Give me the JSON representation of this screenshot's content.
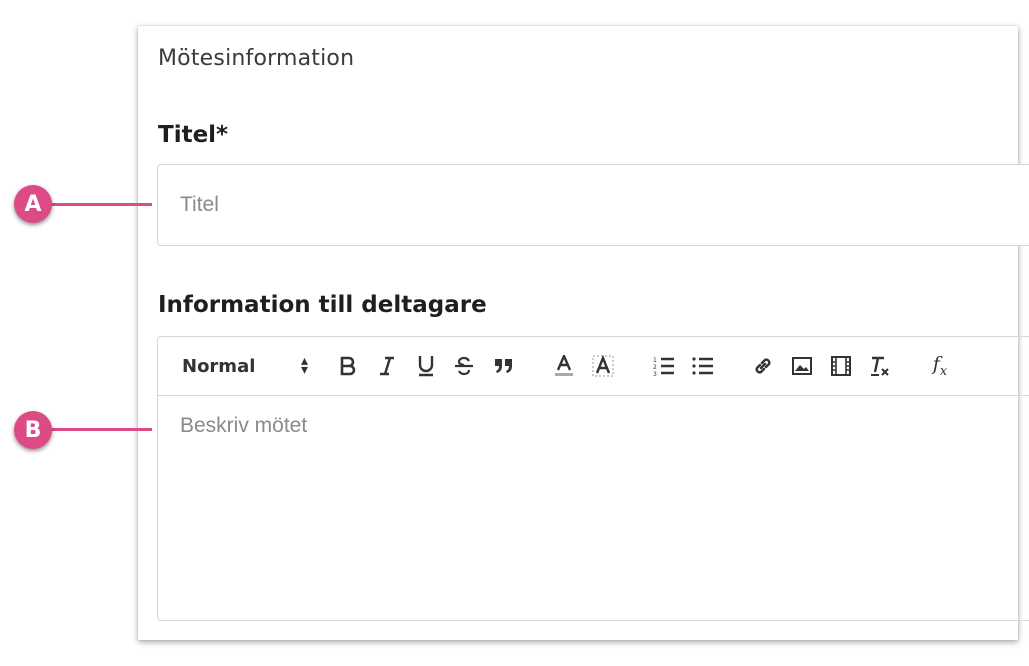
{
  "section": {
    "title": "Mötesinformation"
  },
  "title_field": {
    "label": "Titel*",
    "placeholder": "Titel",
    "value": ""
  },
  "info_field": {
    "label": "Information till deltagare",
    "placeholder": "Beskriv mötet",
    "toolbar": {
      "heading_value": "Normal",
      "buttons": [
        "bold-icon",
        "italic-icon",
        "underline-icon",
        "strikethrough-icon",
        "blockquote-icon",
        "font-color-icon",
        "highlight-icon",
        "ordered-list-icon",
        "bullet-list-icon",
        "link-icon",
        "image-icon",
        "video-icon",
        "clear-format-icon",
        "formula-icon"
      ]
    }
  },
  "callouts": {
    "a": "A",
    "b": "B"
  },
  "colors": {
    "accent": "#dc4b86",
    "border": "#d6d6d6",
    "placeholder": "#8a8a8a"
  }
}
